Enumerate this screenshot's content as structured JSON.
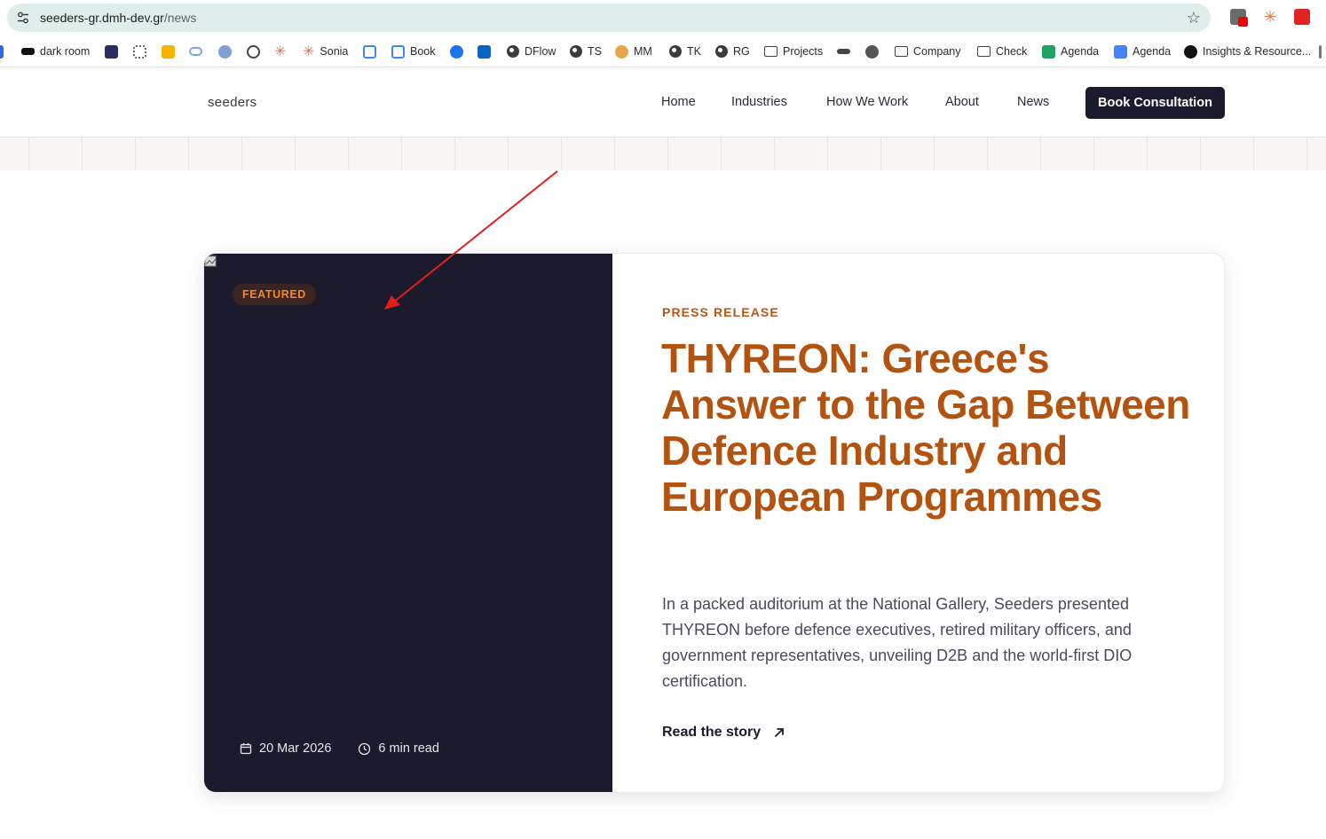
{
  "browser": {
    "url_host": "seeders-gr.dmh-dev.gr",
    "url_path": "/news",
    "bookmarks": [
      {
        "label": "dark room",
        "icon": "darkroom-icon"
      },
      {
        "label": "",
        "icon": "app-icon"
      },
      {
        "label": "",
        "icon": "graph-icon"
      },
      {
        "label": "",
        "icon": "keep-icon"
      },
      {
        "label": "",
        "icon": "link-icon"
      },
      {
        "label": "",
        "icon": "bot-icon"
      },
      {
        "label": "",
        "icon": "openai-icon"
      },
      {
        "label": "",
        "icon": "claude-icon"
      },
      {
        "label": "Sonia",
        "icon": "claude-icon"
      },
      {
        "label": "",
        "icon": "calendar-icon"
      },
      {
        "label": "Book",
        "icon": "calendar-icon"
      },
      {
        "label": "",
        "icon": "check-circle-icon"
      },
      {
        "label": "",
        "icon": "linkedin-icon"
      },
      {
        "label": "DFlow",
        "icon": "globe-icon"
      },
      {
        "label": "TS",
        "icon": "globe-icon"
      },
      {
        "label": "MM",
        "icon": "mm-icon"
      },
      {
        "label": "TK",
        "icon": "globe-icon"
      },
      {
        "label": "RG",
        "icon": "globe-icon"
      },
      {
        "label": "Projects",
        "icon": "folder-icon"
      },
      {
        "label": "",
        "icon": "wave-icon"
      },
      {
        "label": "",
        "icon": "chrome-icon"
      },
      {
        "label": "Company",
        "icon": "folder-icon"
      },
      {
        "label": "Check",
        "icon": "folder-icon"
      },
      {
        "label": "Agenda",
        "icon": "sheets-icon"
      },
      {
        "label": "Agenda",
        "icon": "docs-icon"
      },
      {
        "label": "Insights & Resource...",
        "icon": "triangle-icon"
      }
    ]
  },
  "header": {
    "logo": "seeders",
    "nav": [
      "Home",
      "Industries",
      "How We Work",
      "About",
      "News"
    ],
    "cta": "Book Consultation"
  },
  "featured": {
    "badge": "FEATURED",
    "date": "20 Mar 2026",
    "read_time": "6 min read",
    "category": "PRESS RELEASE",
    "title": "THYREON: Greece's Answer to the Gap Between Defence Industry and European Programmes",
    "excerpt": "In a packed auditorium at the National Gallery, Seeders presented THYREON before defence executives, retired military officers, and government representatives, unveiling D2B and the world-first DIO certification.",
    "link": "Read the story"
  },
  "colors": {
    "accent": "#b3530f",
    "dark": "#1c1b2e",
    "badge_text": "#f08a2a",
    "annotation": "#e51c1c"
  }
}
